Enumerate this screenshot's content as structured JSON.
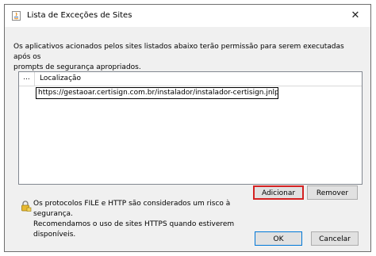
{
  "window": {
    "title": "Lista de Exceções de Sites",
    "close_glyph": "✕"
  },
  "description": "Os aplicativos acionados pelos sites listados abaixo terão permissão para serem executadas após os\nprompts de segurança apropriados.",
  "table": {
    "header_first": "...",
    "header_location": "Localização",
    "rows": [
      {
        "location": "https://gestaoar.certisign.com.br/instalador/instalador-certisign.jnlp"
      }
    ]
  },
  "buttons": {
    "add": "Adicionar",
    "remove": "Remover",
    "ok": "OK",
    "cancel": "Cancelar"
  },
  "security_note": "Os protocolos FILE e HTTP são considerados um risco à segurança.\nRecomendamos o uso de sites HTTPS quando estiverem disponíveis.",
  "icons": {
    "app": "java-app-icon",
    "close": "close-icon",
    "lock": "lock-warning-icon"
  },
  "colors": {
    "focus_border": "#d42222",
    "default_button_border": "#0078d7"
  }
}
